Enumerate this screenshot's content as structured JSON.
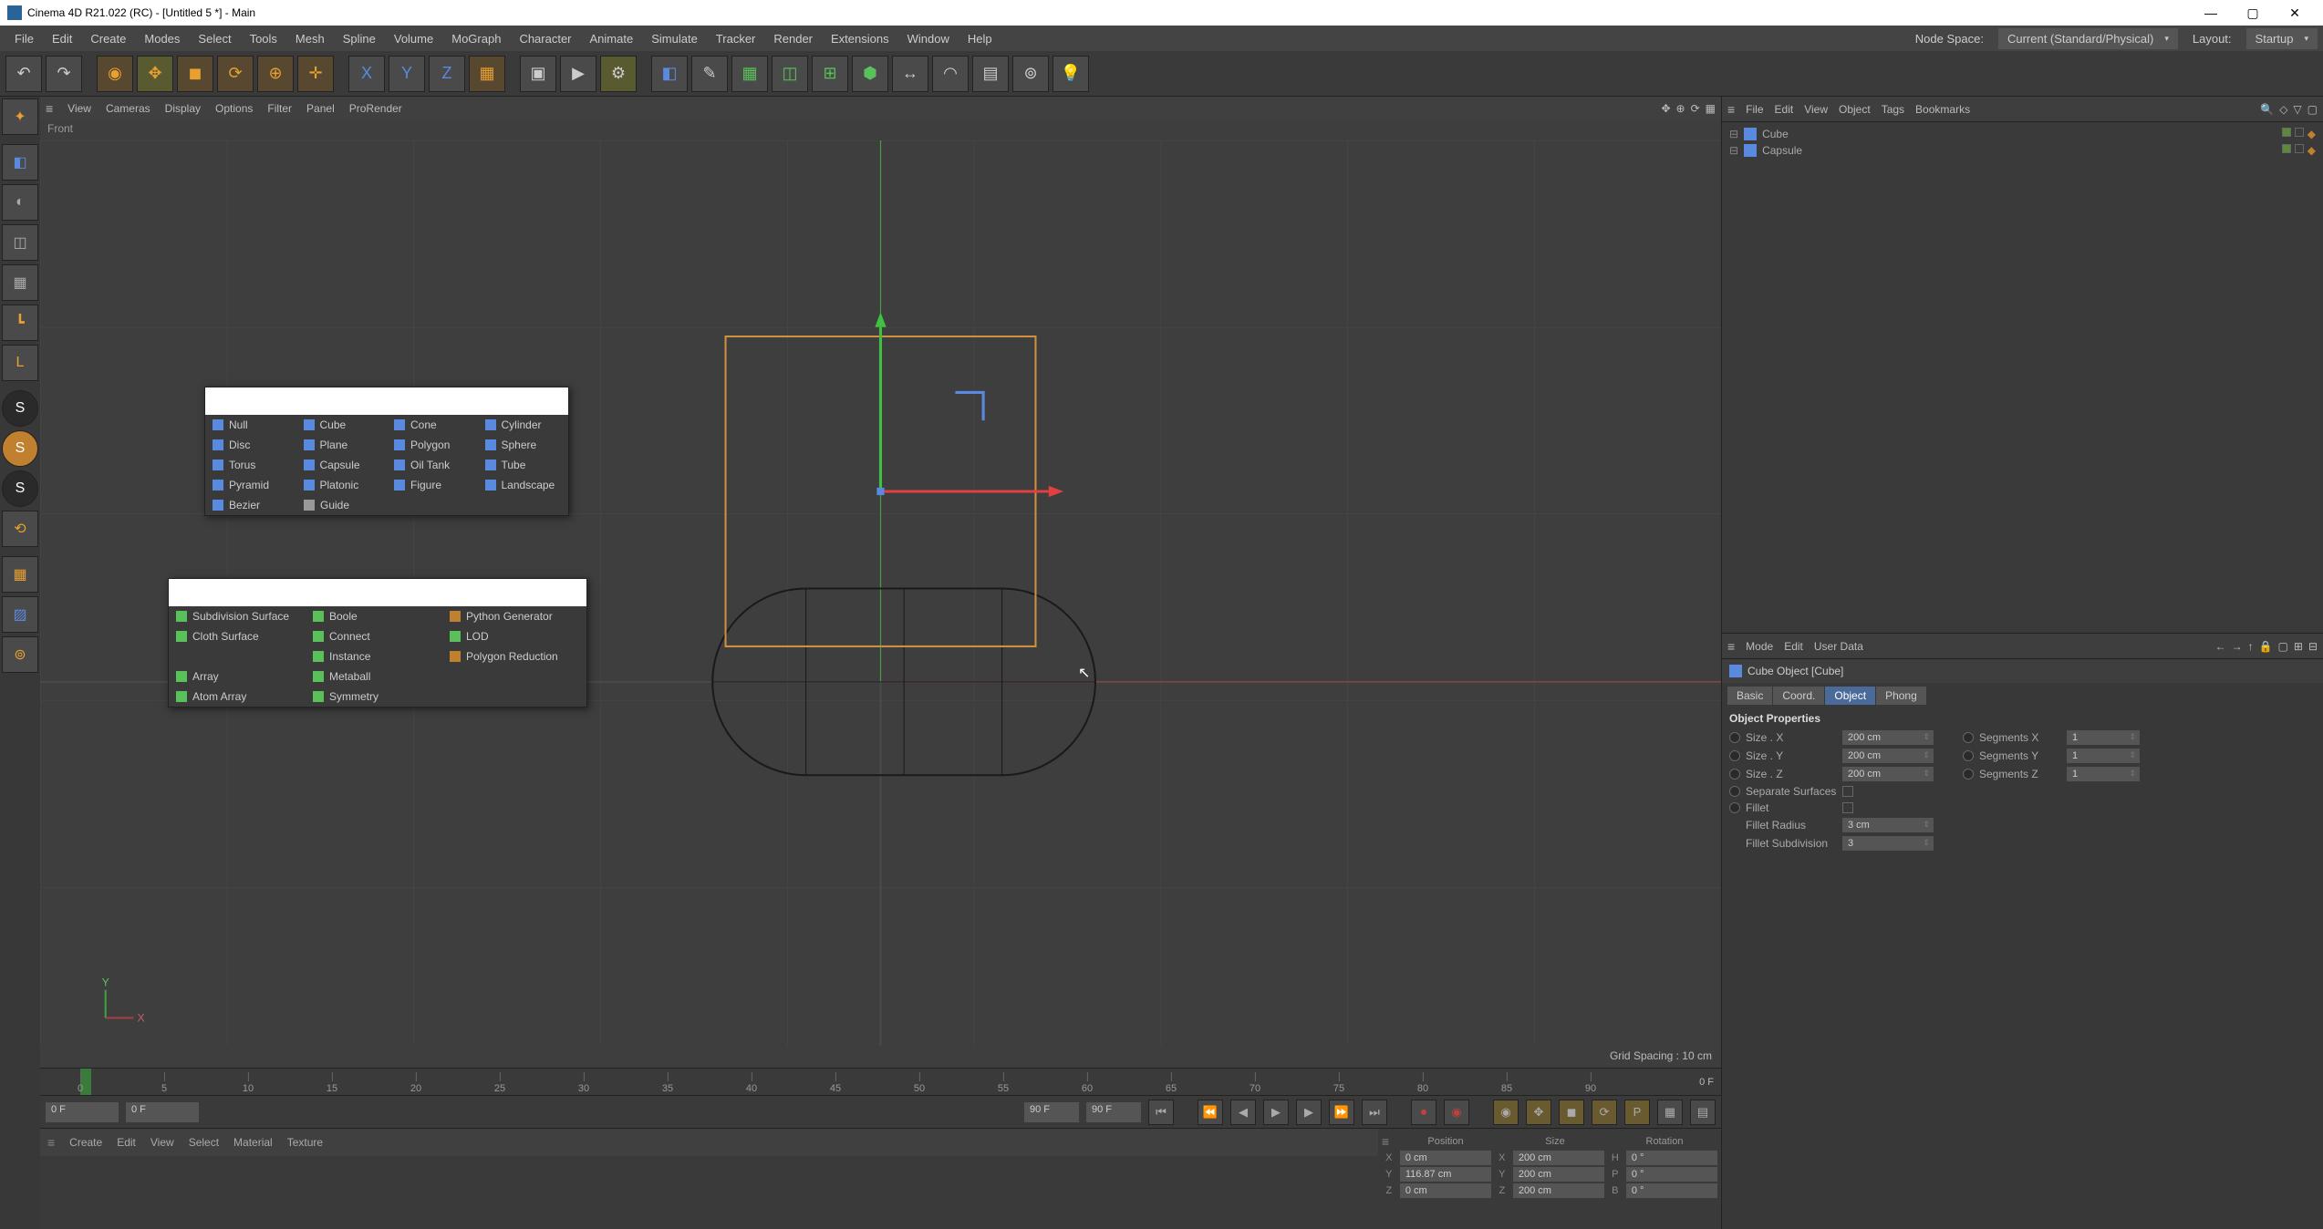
{
  "title": "Cinema 4D R21.022 (RC) - [Untitled 5 *] - Main",
  "menubar": [
    "File",
    "Edit",
    "Create",
    "Modes",
    "Select",
    "Tools",
    "Mesh",
    "Spline",
    "Volume",
    "MoGraph",
    "Character",
    "Animate",
    "Simulate",
    "Tracker",
    "Render",
    "Extensions",
    "Window",
    "Help"
  ],
  "nodeSpaceLabel": "Node Space:",
  "nodeSpace": "Current (Standard/Physical)",
  "layoutLabel": "Layout:",
  "layout": "Startup",
  "viewport": {
    "menu": [
      "View",
      "Cameras",
      "Display",
      "Options",
      "Filter",
      "Panel",
      "ProRender"
    ],
    "label": "Front",
    "gridSpacing": "Grid Spacing : 10 cm",
    "axis": {
      "x": "X",
      "y": "Y"
    }
  },
  "primitivesPopup": [
    [
      {
        "n": "Null",
        "c": "#5a8ae0"
      },
      {
        "n": "Cube",
        "c": "#5a8ae0"
      },
      {
        "n": "Cone",
        "c": "#5a8ae0"
      },
      {
        "n": "Cylinder",
        "c": "#5a8ae0"
      }
    ],
    [
      {
        "n": "Disc",
        "c": "#5a8ae0"
      },
      {
        "n": "Plane",
        "c": "#5a8ae0"
      },
      {
        "n": "Polygon",
        "c": "#5a8ae0"
      },
      {
        "n": "Sphere",
        "c": "#5a8ae0"
      }
    ],
    [
      {
        "n": "Torus",
        "c": "#5a8ae0"
      },
      {
        "n": "Capsule",
        "c": "#5a8ae0"
      },
      {
        "n": "Oil Tank",
        "c": "#5a8ae0"
      },
      {
        "n": "Tube",
        "c": "#5a8ae0"
      }
    ],
    [
      {
        "n": "Pyramid",
        "c": "#5a8ae0"
      },
      {
        "n": "Platonic",
        "c": "#5a8ae0"
      },
      {
        "n": "Figure",
        "c": "#5a8ae0"
      },
      {
        "n": "Landscape",
        "c": "#5a8ae0"
      }
    ],
    [
      {
        "n": "Bezier",
        "c": "#5a8ae0"
      },
      {
        "n": "Guide",
        "c": "#999"
      }
    ]
  ],
  "generatorsPopup": [
    [
      {
        "n": "Subdivision Surface",
        "c": "#5ac05a"
      },
      {
        "n": "Boole",
        "c": "#5ac05a"
      },
      {
        "n": "Python Generator",
        "c": "#c08030"
      }
    ],
    [
      {
        "n": "Cloth Surface",
        "c": "#5ac05a"
      },
      {
        "n": "Connect",
        "c": "#5ac05a"
      },
      {
        "n": "LOD",
        "c": "#5ac05a"
      }
    ],
    [
      {
        "n": "",
        "c": ""
      },
      {
        "n": "Instance",
        "c": "#5ac05a"
      },
      {
        "n": "Polygon Reduction",
        "c": "#c08030"
      }
    ],
    [
      {
        "n": "Array",
        "c": "#5ac05a"
      },
      {
        "n": "Metaball",
        "c": "#5ac05a"
      }
    ],
    [
      {
        "n": "Atom Array",
        "c": "#5ac05a"
      },
      {
        "n": "Symmetry",
        "c": "#5ac05a"
      }
    ]
  ],
  "timelineTicks": [
    "0",
    "5",
    "10",
    "15",
    "20",
    "25",
    "30",
    "35",
    "40",
    "45",
    "50",
    "55",
    "60",
    "65",
    "70",
    "75",
    "80",
    "85",
    "90"
  ],
  "timeline": {
    "startA": "0 F",
    "startB": "0 F",
    "endA": "90 F",
    "endB": "90 F",
    "marker": "0 F"
  },
  "statusbar": [
    "Create",
    "Edit",
    "View",
    "Select",
    "Material",
    "Texture"
  ],
  "coords": {
    "headers": [
      "Position",
      "Size",
      "Rotation"
    ],
    "rows": [
      {
        "axis": "X",
        "pos": "0 cm",
        "size": "200 cm",
        "rlbl": "H",
        "rot": "0 °"
      },
      {
        "axis": "Y",
        "pos": "116.87 cm",
        "size": "200 cm",
        "rlbl": "P",
        "rot": "0 °"
      },
      {
        "axis": "Z",
        "pos": "0 cm",
        "size": "200 cm",
        "rlbl": "B",
        "rot": "0 °"
      }
    ]
  },
  "objPanel": {
    "menu": [
      "File",
      "Edit",
      "View",
      "Object",
      "Tags",
      "Bookmarks"
    ],
    "items": [
      {
        "name": "Cube"
      },
      {
        "name": "Capsule"
      }
    ]
  },
  "attrPanel": {
    "menu": [
      "Mode",
      "Edit",
      "User Data"
    ],
    "title": "Cube Object [Cube]",
    "tabs": [
      "Basic",
      "Coord.",
      "Object",
      "Phong"
    ],
    "activeTab": "Object",
    "section": "Object Properties",
    "props": [
      {
        "l": "Size . X",
        "v": "200 cm",
        "l2": "Segments X",
        "v2": "1"
      },
      {
        "l": "Size . Y",
        "v": "200 cm",
        "l2": "Segments Y",
        "v2": "1"
      },
      {
        "l": "Size . Z",
        "v": "200 cm",
        "l2": "Segments Z",
        "v2": "1"
      }
    ],
    "separate": "Separate Surfaces",
    "fillet": "Fillet",
    "filletRadius": "Fillet Radius",
    "filletRadiusV": "3 cm",
    "filletSub": "Fillet Subdivision",
    "filletSubV": "3"
  }
}
